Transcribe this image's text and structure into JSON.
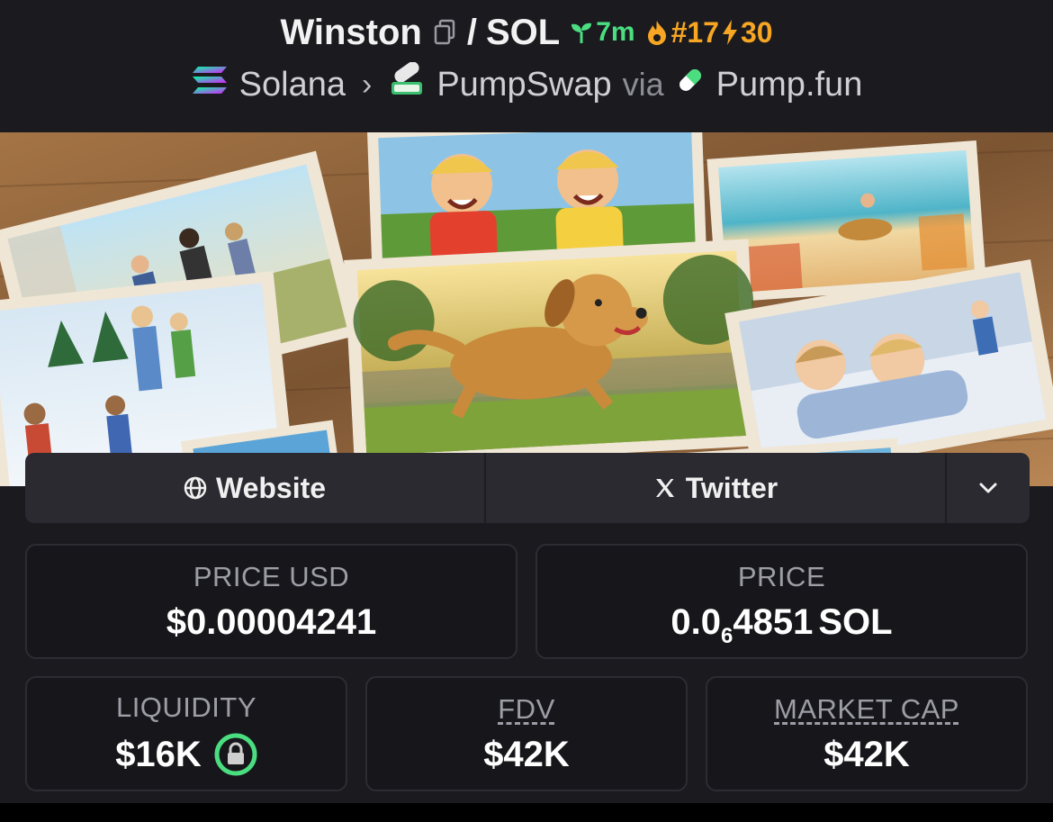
{
  "header": {
    "token_name": "Winston",
    "separator": "/",
    "quote_symbol": "SOL",
    "age": "7m",
    "rank": "#17",
    "boost": "30",
    "chain": "Solana",
    "dex": "PumpSwap",
    "via_label": "via",
    "launchpad": "Pump.fun",
    "icons": {
      "copy": "copy-icon",
      "age": "sprout-icon",
      "rank": "flame-icon",
      "boost": "lightning-icon"
    }
  },
  "links": {
    "website_label": "Website",
    "twitter_label": "Twitter",
    "icons": {
      "website": "globe-icon",
      "twitter": "x-icon",
      "more": "chevron-down-icon"
    }
  },
  "stats": {
    "price_usd": {
      "label": "PRICE USD",
      "value": "$0.00004241"
    },
    "price_native": {
      "label": "PRICE",
      "prefix": "0.0",
      "zero_count": "6",
      "digits": "4851",
      "unit": "SOL"
    },
    "liquidity": {
      "label": "LIQUIDITY",
      "value": "$16K",
      "icon": "lock-icon"
    },
    "fdv": {
      "label": "FDV",
      "value": "$42K"
    },
    "market_cap": {
      "label": "MARKET CAP",
      "value": "$42K"
    }
  },
  "colors": {
    "background": "#1a1a1f",
    "green": "#4ade80",
    "orange": "#f6a623",
    "card_border": "#2c2c33"
  }
}
